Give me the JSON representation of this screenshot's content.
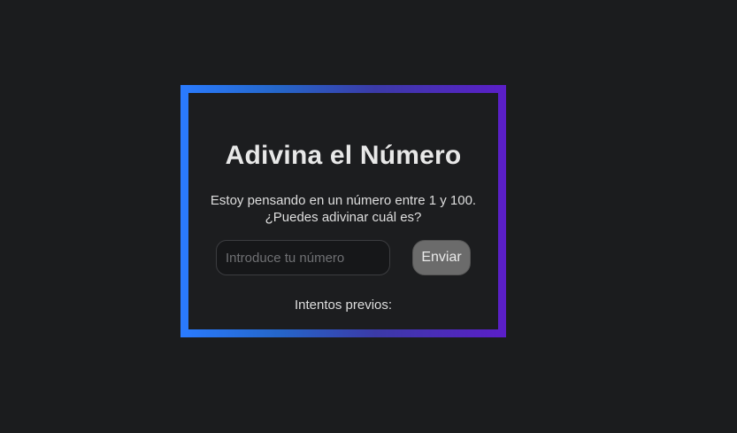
{
  "game": {
    "title": "Adivina el Número",
    "description_line1": "Estoy pensando en un número entre 1 y 100.",
    "description_line2": "¿Puedes adivinar cuál es?",
    "input_placeholder": "Introduce tu número",
    "input_value": "",
    "submit_label": "Enviar",
    "previous_label": "Intentos previos:",
    "previous_attempts": ""
  },
  "colors": {
    "background": "#1b1c1e",
    "card": "#1c1d1f",
    "border_gradient_start": "#2a7bff",
    "border_gradient_end": "#5b1ec8",
    "button": "#6b6b6b"
  }
}
